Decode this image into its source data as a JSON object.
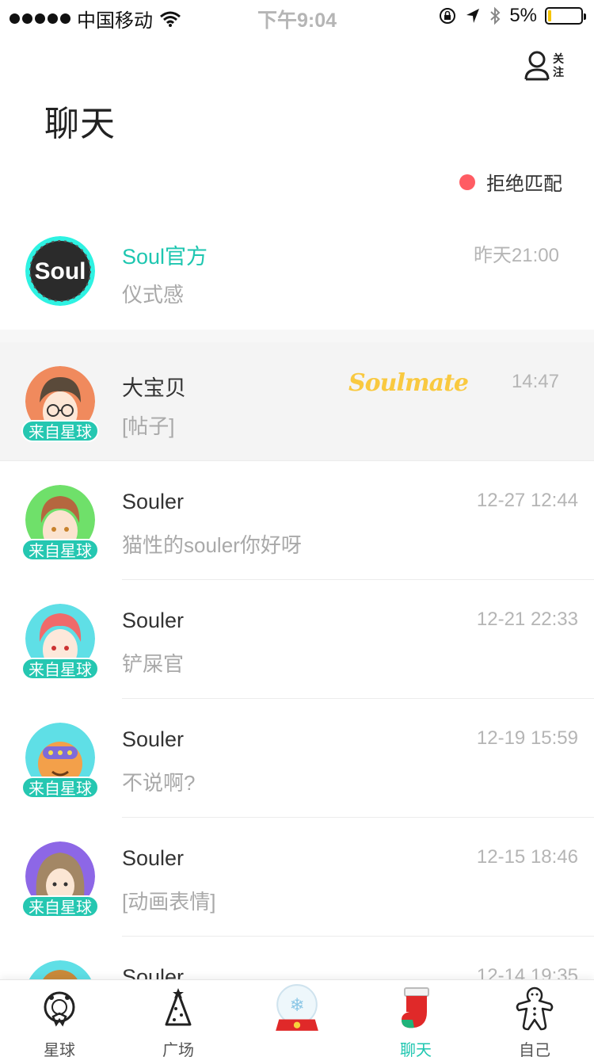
{
  "status_bar": {
    "carrier": "中国移动",
    "time": "下午9:04",
    "battery_percent": "5%",
    "battery_level": 0.05
  },
  "header": {
    "title": "聊天",
    "follow_label": "关注",
    "reject_label": "拒绝匹配",
    "reject_dot_color": "#ff5c63"
  },
  "colors": {
    "accent": "#1ec6b0",
    "badge": "#25c7b1",
    "soulmate": "#f9c940"
  },
  "chats": [
    {
      "name": "Soul官方",
      "message": "仪式感",
      "time": "昨天21:00",
      "official": true,
      "avatar_icon": "soul-logo-avatar"
    },
    {
      "name": "大宝贝",
      "message": "[帖子]",
      "time": "14:47",
      "badge": "来自星球",
      "tag": "Soulmate",
      "highlight": true,
      "avatar_icon": "avatar-boy-glasses"
    },
    {
      "name": "Souler",
      "message": "猫性的souler你好呀",
      "time": "12-27 12:44",
      "badge": "来自星球",
      "avatar_icon": "avatar-boy-green"
    },
    {
      "name": "Souler",
      "message": "铲屎官",
      "time": "12-21 22:33",
      "badge": "来自星球",
      "avatar_icon": "avatar-boy-pink-hair"
    },
    {
      "name": "Souler",
      "message": "不说啊?",
      "time": "12-19 15:59",
      "badge": "来自星球",
      "avatar_icon": "avatar-robot-orange"
    },
    {
      "name": "Souler",
      "message": "[动画表情]",
      "time": "12-15 18:46",
      "badge": "来自星球",
      "avatar_icon": "avatar-girl-purple"
    },
    {
      "name": "Souler",
      "message": "",
      "time": "12-14 19:35",
      "badge": "",
      "avatar_icon": "avatar-partial"
    }
  ],
  "tabs": [
    {
      "label": "星球",
      "icon": "wreath-icon",
      "active": false
    },
    {
      "label": "广场",
      "icon": "tree-icon",
      "active": false
    },
    {
      "label": "",
      "icon": "snow-globe-icon",
      "active": false
    },
    {
      "label": "聊天",
      "icon": "stocking-icon",
      "active": true
    },
    {
      "label": "自己",
      "icon": "gingerbread-icon",
      "active": false
    }
  ]
}
